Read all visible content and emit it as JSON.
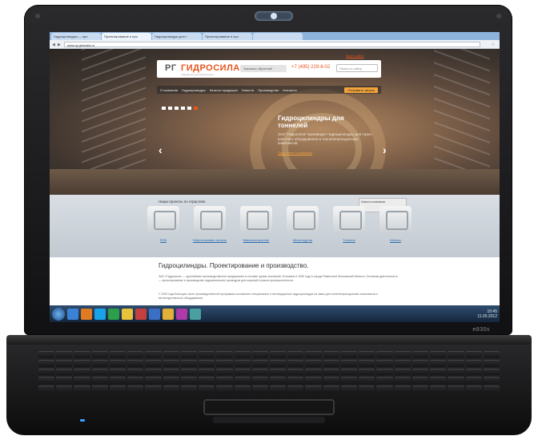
{
  "browser": {
    "tabs": [
      {
        "label": "Гидроцилиндры — про",
        "active": false
      },
      {
        "label": "Проектирование и про",
        "active": true
      },
      {
        "label": "Гидроцилиндры для т",
        "active": false
      },
      {
        "label": "Проектирование и про",
        "active": false
      },
      {
        "label": "",
        "active": false
      }
    ],
    "url": "www.rg-gidrosila.ru"
  },
  "header": {
    "logo_prefix": "РГ",
    "logo_name": "ГИДРОСИЛА",
    "logo_tagline": "гидравлика для металлургии",
    "callback_label": "Заказать обратный",
    "phone": "+7 (495) 229-8-02",
    "search_placeholder": "Поиск по сайту",
    "site_link": "Карта сайта"
  },
  "menu": {
    "items": [
      "О компании",
      "Гидроцилиндры",
      "Каталог продукции",
      "Новости",
      "Производство",
      "Контакты"
    ],
    "cta": "Отправить запрос"
  },
  "slider": {
    "title": "Гидроцилиндры для тоннелей",
    "description": "ЗАО \"Гидросила\" производит гидроцилиндры для горно-шахтного оборудования и тоннелепроходческих комплексов.",
    "more_link": "Подробнее о компании",
    "dots": 6,
    "active_dot": 5
  },
  "projects": {
    "title": "Наши проекты по отраслям:",
    "news_label": "Новости компании",
    "items": [
      {
        "label": "ВПК",
        "icon": "crane-icon"
      },
      {
        "label": "Нефтегазовая отрасль",
        "icon": "oil-pump-icon"
      },
      {
        "label": "Машиностроение",
        "icon": "machinery-icon"
      },
      {
        "label": "Металлургия",
        "icon": "metallurgy-icon"
      },
      {
        "label": "Тоннели",
        "icon": "tunnel-icon"
      },
      {
        "label": "Шлюзы",
        "icon": "sluice-icon"
      }
    ]
  },
  "content": {
    "title": "Гидроцилиндры. Проектирование и производство.",
    "paragraph1": "ЗАО «Гидросила» — крупнейшее производственное предприятие в составе группы компаний. Основано в 1990 году в городе Раменское Московской области. Основная деятельность — проектирование и производство гидравлических цилиндров для широкой отрасли промышленности.",
    "paragraph2": "С 2000 года большую часть производственной программы составляют специальные и нестандартные гидроцилиндры на заказ для тоннелепроходческих комплексов и металлургического оборудования."
  },
  "taskbar": {
    "tray_time": "10:45",
    "tray_date": "11.05.2012",
    "icons": [
      "ie-icon",
      "media-player-icon",
      "skype-icon",
      "app-icon",
      "folder-icon",
      "browser-icon",
      "document-icon",
      "explorer-icon",
      "app2-icon",
      "app3-icon"
    ]
  },
  "device": {
    "model": "e830s"
  },
  "colors": {
    "accent": "#e8551e",
    "cta": "#f2a33a",
    "link": "#2a6bb0"
  }
}
